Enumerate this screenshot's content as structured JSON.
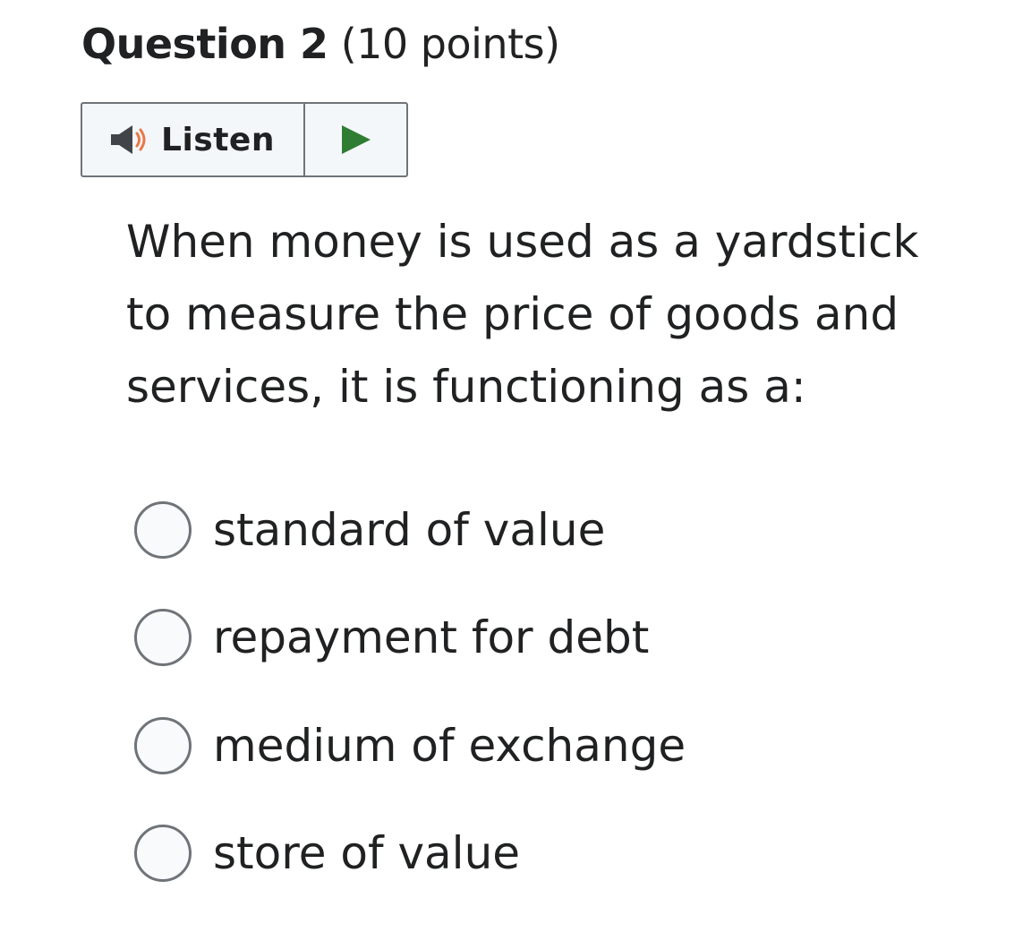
{
  "question": {
    "title": "Question 2",
    "points": "(10 points)"
  },
  "listen": {
    "label": "Listen",
    "speaker_icon": "speaker-icon",
    "play_icon": "play-icon",
    "colors": {
      "speaker_body": "#41454a",
      "sound_waves": "#e8794a",
      "play": "#2e7d32"
    }
  },
  "prompt": {
    "lines": [
      "When money is used as a yardstick",
      "to measure the price of goods and",
      "services, it is functioning as a:"
    ]
  },
  "options": [
    {
      "label": "standard of value",
      "selected": false
    },
    {
      "label": "repayment for debt",
      "selected": false
    },
    {
      "label": "medium of exchange",
      "selected": false
    },
    {
      "label": "store of value",
      "selected": false
    }
  ]
}
